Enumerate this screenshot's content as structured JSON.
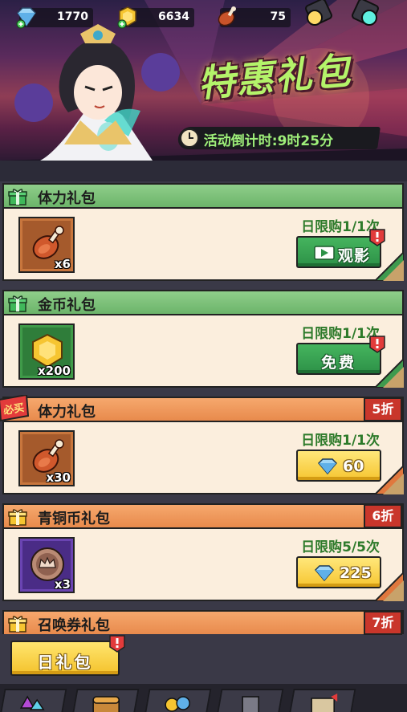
{
  "currencies": {
    "diamond": {
      "value": "1770",
      "icon": "diamond-plus-icon"
    },
    "gold": {
      "value": "6634",
      "icon": "gold-coin-plus-icon"
    },
    "stamina": {
      "value": "75",
      "icon": "meat-icon"
    }
  },
  "banner": {
    "title": "特惠礼包",
    "countdown": "活动倒计时:9时25分"
  },
  "packs": [
    {
      "title": "体力礼包",
      "header_color": "green",
      "item_icon": "meat-icon",
      "item_qty": "x6",
      "limit": "日限购1/1次",
      "button": "观影",
      "button_style": "green",
      "button_icon": "video-icon",
      "has_red_dot": true,
      "discount": null,
      "must_buy": false
    },
    {
      "title": "金币礼包",
      "header_color": "green",
      "item_icon": "gold-coin-icon",
      "item_qty": "x200",
      "limit": "日限购1/1次",
      "button": "免费",
      "button_style": "green",
      "button_icon": null,
      "has_red_dot": true,
      "discount": null,
      "must_buy": false
    },
    {
      "title": "体力礼包",
      "header_color": "orange",
      "item_icon": "meat-icon",
      "item_qty": "x30",
      "limit": "日限购1/1次",
      "button": "60",
      "button_style": "yellow",
      "button_icon": "diamond-icon",
      "has_red_dot": false,
      "discount": "5折",
      "must_buy": true,
      "must_buy_label": "必买"
    },
    {
      "title": "青铜币礼包",
      "header_color": "orange",
      "item_icon": "bronze-coin-icon",
      "item_qty": "x3",
      "limit": "日限购5/5次",
      "button": "225",
      "button_style": "yellow",
      "button_icon": "diamond-icon",
      "has_red_dot": false,
      "discount": "6折",
      "must_buy": false
    },
    {
      "title": "召唤券礼包",
      "header_color": "orange",
      "discount": "7折",
      "must_buy": false
    }
  ],
  "daily_button": {
    "label": "日礼包",
    "has_red_dot": true
  },
  "colors": {
    "accent_green": "#45b45e",
    "accent_yellow": "#f6c531",
    "discount_red": "#c9362b",
    "limit_text": "#2d7a2a"
  }
}
